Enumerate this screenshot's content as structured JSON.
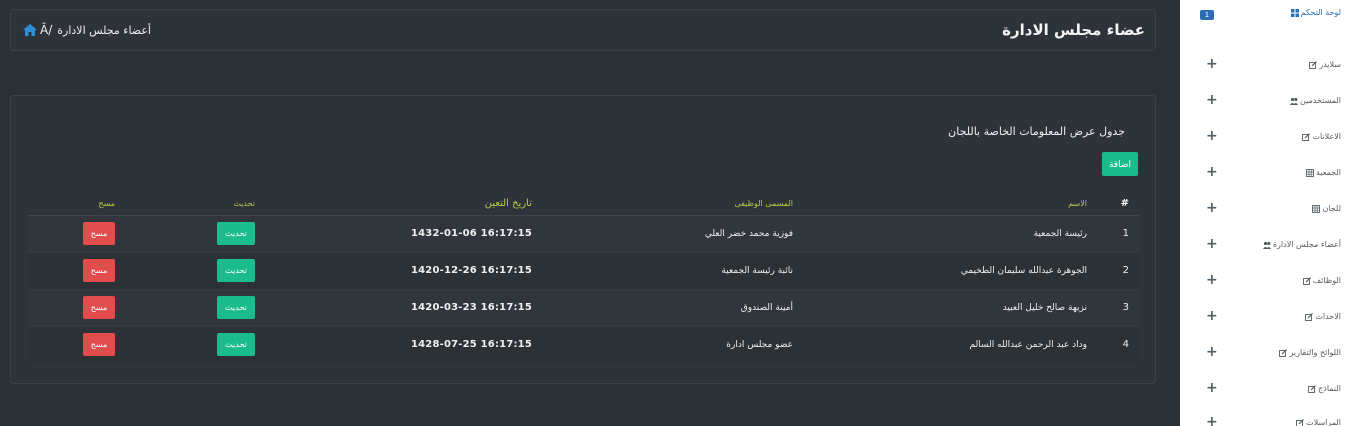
{
  "header": {
    "title": "عضاء مجلس الادارة",
    "breadcrumb_text": "أعضاء مجلس الادارة",
    "breadcrumb_sep": "Â/"
  },
  "panel": {
    "heading": "جدول عرض المعلومات الخاصة باللجان",
    "add_label": "اضافة"
  },
  "table": {
    "columns": [
      "#",
      "الاسم",
      "المسمى الوظيفى",
      "تاريخ التعين",
      "تحديث",
      "مسح"
    ],
    "rows": [
      {
        "num": "1",
        "name": "رئيسة الجمعية",
        "title": "فوزية محمد خضر العلي",
        "date": "16:17:15 1432-01-06",
        "update": "تحديث",
        "delete": "مسح"
      },
      {
        "num": "2",
        "name": "الجوهرة عبدالله سليمان الطخيمي",
        "title": "نائبة رئيسة الجمعية",
        "date": "16:17:15 1420-12-26",
        "update": "تحديث",
        "delete": "مسح"
      },
      {
        "num": "3",
        "name": "نزيهة صالح خليل العبيد",
        "title": "أمينة الصندوق",
        "date": "16:17:15 1420-03-23",
        "update": "تحديث",
        "delete": "مسح"
      },
      {
        "num": "4",
        "name": "وداد عبد الرحمن عبدالله السالم",
        "title": "عضو مجلس ادارة",
        "date": "16:17:15 1428-07-25",
        "update": "تحديث",
        "delete": "مسح"
      }
    ]
  },
  "sidebar": {
    "items": [
      {
        "label": "لوحة التحكم",
        "icon": "dashboard-icon",
        "badge": "1"
      },
      {
        "label": "سلايدر",
        "icon": "edit-icon"
      },
      {
        "label": "المستخدمين",
        "icon": "users-icon"
      },
      {
        "label": "الاعلانات",
        "icon": "edit-icon"
      },
      {
        "label": "الجمعية",
        "icon": "table-icon"
      },
      {
        "label": "للجان",
        "icon": "table-icon"
      },
      {
        "label": "أعضاء مجلس الادارة",
        "icon": "users-icon"
      },
      {
        "label": "الوظائف",
        "icon": "edit-icon"
      },
      {
        "label": "الاحداث",
        "icon": "edit-icon"
      },
      {
        "label": "اللوائح والتقارير",
        "icon": "edit-icon"
      },
      {
        "label": "النماذج",
        "icon": "edit-icon"
      },
      {
        "label": "المراسلات",
        "icon": "edit-icon"
      }
    ]
  },
  "colors": {
    "accent_green": "#1abc8c",
    "danger_red": "#e24c4c",
    "header_yellow": "#b8c94a",
    "link_blue": "#2a72b5"
  }
}
